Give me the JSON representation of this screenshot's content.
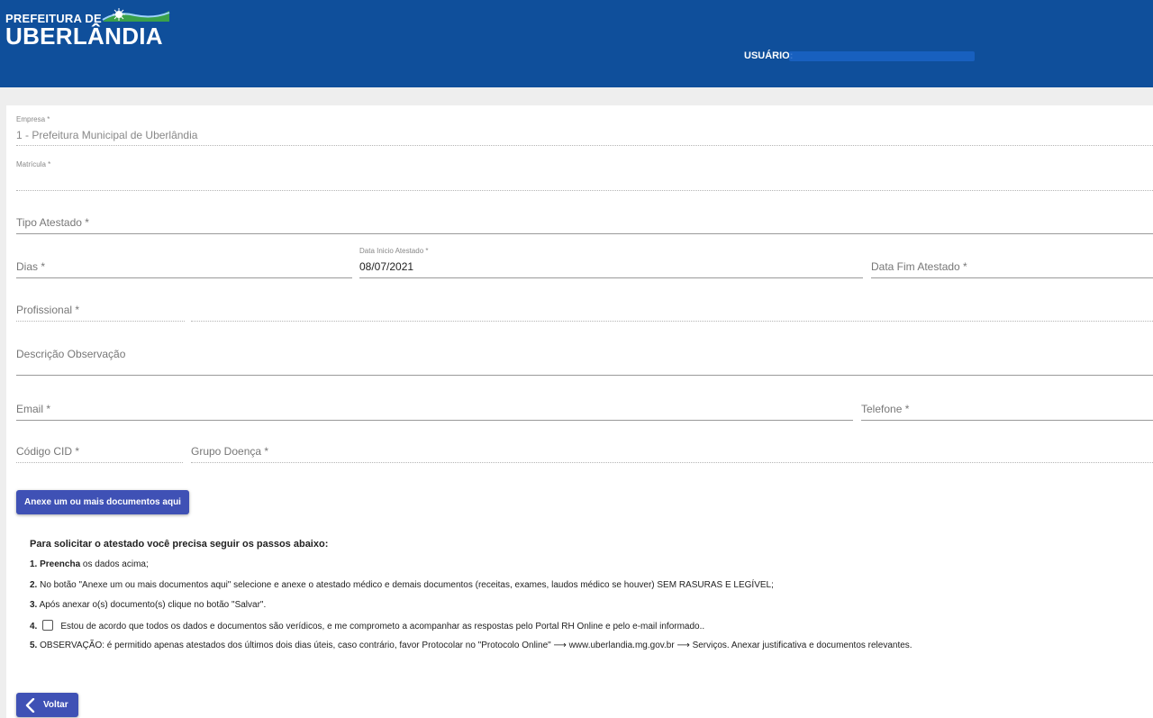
{
  "header": {
    "logo_top": "PREFEITURA DE",
    "logo_main": "UBERLÂNDIA",
    "user_label": "USUÁRIO:"
  },
  "form": {
    "empresa": {
      "label": "Empresa *",
      "value": "1 - Prefeitura Municipal de Uberlândia"
    },
    "matricula": {
      "label": "Matrícula *",
      "value": ""
    },
    "tipo_atestado": {
      "placeholder": "Tipo Atestado *"
    },
    "dias": {
      "placeholder": "Dias *"
    },
    "data_inicio": {
      "label": "Data Inicio Atestado *",
      "value": "08/07/2021"
    },
    "data_fim": {
      "placeholder": "Data Fim Atestado *"
    },
    "profissional": {
      "placeholder": "Profissional *"
    },
    "descricao": {
      "placeholder": "Descrição Observação"
    },
    "email": {
      "placeholder": "Email *"
    },
    "telefone": {
      "placeholder": "Telefone *"
    },
    "codigo_cid": {
      "placeholder": "Código CID *"
    },
    "grupo_doenca": {
      "placeholder": "Grupo Doença *"
    }
  },
  "attach_button": "Anexe um ou mais documentos aqui",
  "instructions": {
    "title": "Para solicitar o atestado você precisa seguir os passos abaixo:",
    "step1_num": "1.",
    "step1_bold": "Preencha",
    "step1_text": " os dados acima;",
    "step2_num": "2.",
    "step2_text": " No botão \"Anexe um ou mais documentos aqui\" selecione e anexe o atestado médico e demais documentos (receitas, exames, laudos médico se houver) SEM RASURAS E LEGÍVEL;",
    "step3_num": "3.",
    "step3_text": " Após anexar o(s) documento(s) clique no botão \"Salvar\".",
    "step4_num": "4.",
    "step4_text": "Estou de acordo que todos os dados e documentos são verídicos, e me comprometo a acompanhar as respostas pelo Portal RH Online e pelo e-mail informado..",
    "step5_num": "5.",
    "step5_text": " OBSERVAÇÃO: é permitido apenas atestados dos últimos dois dias úteis, caso contrário, favor Protocolar no \"Protocolo Online\" ⟶ www.uberlandia.mg.gov.br ⟶ Serviços. Anexar justificativa e documentos relevantes."
  },
  "back_button": "Voltar",
  "colors": {
    "header_bg": "#0f4f9b",
    "button_bg": "#3f51b5"
  }
}
